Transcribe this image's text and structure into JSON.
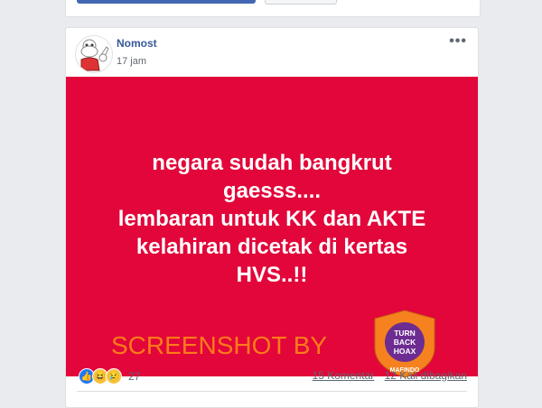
{
  "post": {
    "author": "Nomost",
    "time": "17 jam",
    "menu": "•••",
    "text_lines": [
      "negara sudah bangkrut",
      "gaesss....",
      "lembaran untuk KK dan AKTE",
      "kelahiran dicetak di kertas",
      "HVS..!!"
    ],
    "watermark": "SCREENSHOT BY",
    "logo_text": {
      "center_1": "TURN",
      "center_2": "BACK",
      "center_3": "HOAX",
      "banner": "MAFINDO"
    }
  },
  "engagement": {
    "reaction_count": "27",
    "comments": "15 Komentar",
    "shares": "12 Kali dibagikan"
  },
  "colors": {
    "image_bg": "#e2063a",
    "watermark": "#ff7a1a",
    "author": "#365899"
  }
}
